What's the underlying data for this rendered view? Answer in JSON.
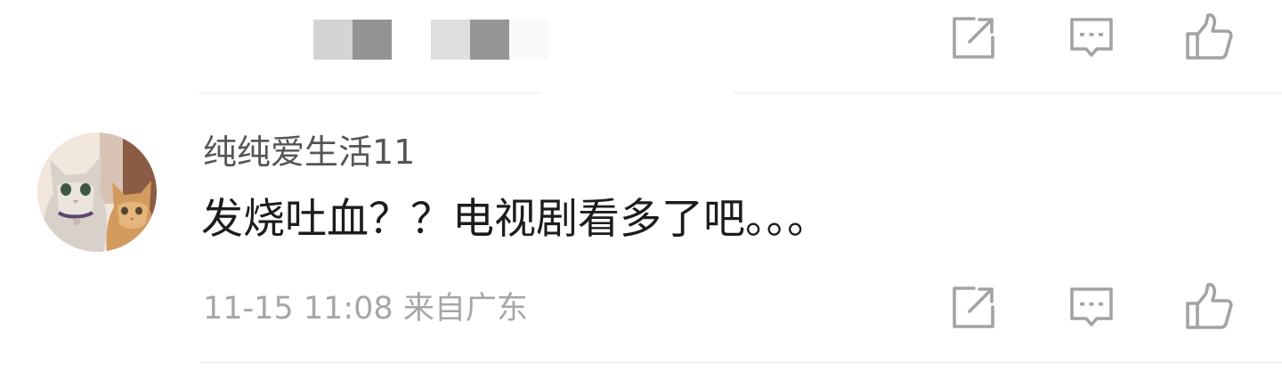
{
  "previous_comment": {
    "actions": {
      "share_icon": "share-icon",
      "reply_icon": "comment-icon",
      "like_icon": "thumbs-up-icon"
    }
  },
  "comment": {
    "avatar_icon": "cat-avatar",
    "username": "纯纯爱生活11",
    "text": "发烧吐血？？电视剧看多了吧。。。",
    "meta": "11-15 11:08 来自广东",
    "actions": {
      "share_icon": "share-icon",
      "reply_icon": "comment-icon",
      "like_icon": "thumbs-up-icon"
    }
  },
  "colors": {
    "icon": "#a3a3a3",
    "username": "#555555",
    "text": "#1c1c1c",
    "meta": "#a6a6a6",
    "divider": "#e8e8e8"
  }
}
